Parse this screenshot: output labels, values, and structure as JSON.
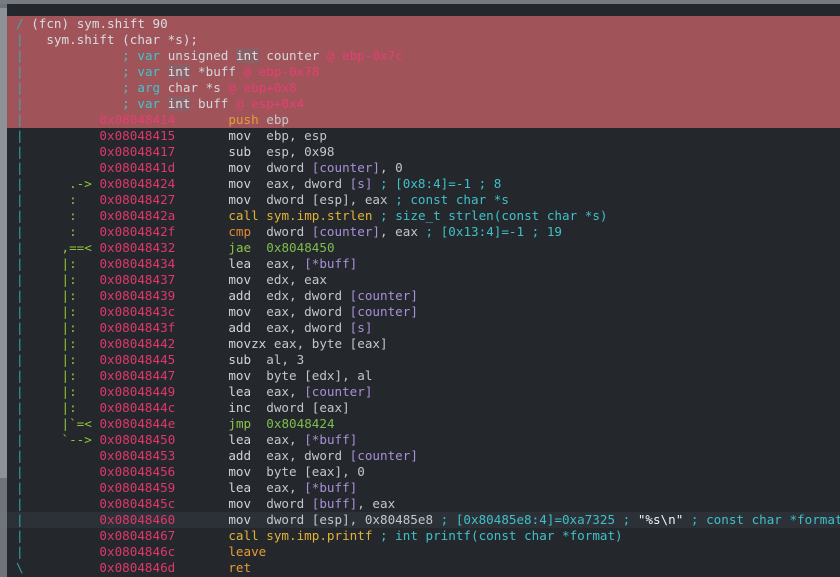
{
  "app": {
    "name": "radare2-disassembly-view",
    "theme": "dark"
  },
  "colors": {
    "background": "#24282d",
    "header_highlight": "#a0545a",
    "cursor_row": "#2c3138",
    "address": "#e0376b",
    "comment": "#3fc0c9",
    "jump": "#8bc34a",
    "call": "#e2b23a",
    "stack_op": "#e79c34",
    "variable": "#a98fd8",
    "flow_bar": "#2fa3a8",
    "arrow": "#8fc63d",
    "scrollbar": "#8d9299"
  },
  "function": {
    "marker": "/",
    "label": "(fcn)",
    "name": "sym.shift",
    "size": "90",
    "signature": "sym.shift (char *s);"
  },
  "variables": [
    {
      "gutter": "|",
      "semi": ";",
      "kind": "var",
      "qualifier": "unsigned ",
      "type": "int",
      "name": " counter ",
      "at": "@ ebp-0x7c"
    },
    {
      "gutter": "|",
      "semi": ";",
      "kind": "var",
      "qualifier": "",
      "type": "int",
      "name": " *buff ",
      "at": "@ ebp-0x78"
    },
    {
      "gutter": "|",
      "semi": ";",
      "kind": "arg",
      "qualifier": "",
      "type": "char",
      "name": " *s ",
      "at": "@ ebp+0x8"
    },
    {
      "gutter": "|",
      "semi": ";",
      "kind": "var",
      "qualifier": "",
      "type": "int",
      "name": " buff ",
      "at": "@ esp+0x4"
    }
  ],
  "instructions": [
    {
      "gutter": "|",
      "arrow": "",
      "addr": "0x08048414",
      "mn": "push",
      "mnclass": "c-push",
      "highlight": true,
      "cursor": false
    },
    {
      "gutter": "|",
      "arrow": "",
      "addr": "0x08048415",
      "mn": "mov",
      "mnclass": "c-op",
      "highlight": false,
      "cursor": false
    },
    {
      "gutter": "|",
      "arrow": "",
      "addr": "0x08048417",
      "mn": "sub",
      "mnclass": "c-op",
      "highlight": false,
      "cursor": false
    },
    {
      "gutter": "|",
      "arrow": "",
      "addr": "0x0804841d",
      "mn": "mov",
      "mnclass": "c-op",
      "highlight": false,
      "cursor": false
    },
    {
      "gutter": "|",
      "arrow": ".->",
      "addr": "0x08048424",
      "mn": "mov",
      "mnclass": "c-op",
      "highlight": false,
      "cursor": false
    },
    {
      "gutter": "|",
      "arrow": ":",
      "addr": "0x08048427",
      "mn": "mov",
      "mnclass": "c-op",
      "highlight": false,
      "cursor": false
    },
    {
      "gutter": "|",
      "arrow": ":",
      "addr": "0x0804842a",
      "mn": "call",
      "mnclass": "c-call",
      "highlight": false,
      "cursor": false
    },
    {
      "gutter": "|",
      "arrow": ":",
      "addr": "0x0804842f",
      "mn": "cmp",
      "mnclass": "c-cmp",
      "highlight": false,
      "cursor": false
    },
    {
      "gutter": "|",
      "arrow": ",==<",
      "addr": "0x08048432",
      "mn": "jae",
      "mnclass": "c-jmp",
      "highlight": false,
      "cursor": false
    },
    {
      "gutter": "|",
      "arrow": "|:",
      "addr": "0x08048434",
      "mn": "lea",
      "mnclass": "c-op",
      "highlight": false,
      "cursor": false
    },
    {
      "gutter": "|",
      "arrow": "|:",
      "addr": "0x08048437",
      "mn": "mov",
      "mnclass": "c-op",
      "highlight": false,
      "cursor": false
    },
    {
      "gutter": "|",
      "arrow": "|:",
      "addr": "0x08048439",
      "mn": "add",
      "mnclass": "c-op",
      "highlight": false,
      "cursor": false
    },
    {
      "gutter": "|",
      "arrow": "|:",
      "addr": "0x0804843c",
      "mn": "mov",
      "mnclass": "c-op",
      "highlight": false,
      "cursor": false
    },
    {
      "gutter": "|",
      "arrow": "|:",
      "addr": "0x0804843f",
      "mn": "add",
      "mnclass": "c-op",
      "highlight": false,
      "cursor": false
    },
    {
      "gutter": "|",
      "arrow": "|:",
      "addr": "0x08048442",
      "mn": "movzx",
      "mnclass": "c-op",
      "highlight": false,
      "cursor": false
    },
    {
      "gutter": "|",
      "arrow": "|:",
      "addr": "0x08048445",
      "mn": "sub",
      "mnclass": "c-op",
      "highlight": false,
      "cursor": false
    },
    {
      "gutter": "|",
      "arrow": "|:",
      "addr": "0x08048447",
      "mn": "mov",
      "mnclass": "c-op",
      "highlight": false,
      "cursor": false
    },
    {
      "gutter": "|",
      "arrow": "|:",
      "addr": "0x08048449",
      "mn": "lea",
      "mnclass": "c-op",
      "highlight": false,
      "cursor": false
    },
    {
      "gutter": "|",
      "arrow": "|:",
      "addr": "0x0804844c",
      "mn": "inc",
      "mnclass": "c-op",
      "highlight": false,
      "cursor": false
    },
    {
      "gutter": "|",
      "arrow": "|`=<",
      "addr": "0x0804844e",
      "mn": "jmp",
      "mnclass": "c-jmp",
      "highlight": false,
      "cursor": false
    },
    {
      "gutter": "|",
      "arrow": "`-->",
      "addr": "0x08048450",
      "mn": "lea",
      "mnclass": "c-op",
      "highlight": false,
      "cursor": false
    },
    {
      "gutter": "|",
      "arrow": "",
      "addr": "0x08048453",
      "mn": "add",
      "mnclass": "c-op",
      "highlight": false,
      "cursor": false
    },
    {
      "gutter": "|",
      "arrow": "",
      "addr": "0x08048456",
      "mn": "mov",
      "mnclass": "c-op",
      "highlight": false,
      "cursor": false
    },
    {
      "gutter": "|",
      "arrow": "",
      "addr": "0x08048459",
      "mn": "lea",
      "mnclass": "c-op",
      "highlight": false,
      "cursor": false
    },
    {
      "gutter": "|",
      "arrow": "",
      "addr": "0x0804845c",
      "mn": "mov",
      "mnclass": "c-op",
      "highlight": false,
      "cursor": false
    },
    {
      "gutter": "|",
      "arrow": "",
      "addr": "0x08048460",
      "mn": "mov",
      "mnclass": "c-op",
      "highlight": false,
      "cursor": true
    },
    {
      "gutter": "|",
      "arrow": "",
      "addr": "0x08048467",
      "mn": "call",
      "mnclass": "c-call",
      "highlight": false,
      "cursor": false
    },
    {
      "gutter": "|",
      "arrow": "",
      "addr": "0x0804846c",
      "mn": "leave",
      "mnclass": "c-push",
      "highlight": false,
      "cursor": false
    },
    {
      "gutter": "\\",
      "arrow": "",
      "addr": "0x0804846d",
      "mn": "ret",
      "mnclass": "c-push",
      "highlight": false,
      "cursor": false
    }
  ],
  "operands": {
    "push_ebp": "ebp",
    "mov_ebp_esp": "ebp, esp",
    "sub_esp": "esp, 0x98",
    "mov_counter_0_pre": "dword ",
    "mov_counter_0_var": "[counter]",
    "mov_counter_0_post": ", 0",
    "mov_eax_s_pre": "eax, dword ",
    "mov_eax_s_var": "[s]",
    "mov_esp_eax": "dword [esp], eax",
    "call_strlen": "sym.imp.strlen",
    "cmp_counter_pre": "dword ",
    "cmp_counter_var": "[counter]",
    "cmp_counter_post": ", eax",
    "jae_target": "0x8048450",
    "lea_buff_pre": "eax, ",
    "lea_buff_var": "[*buff]",
    "mov_edx_eax": "edx, eax",
    "add_edx_counter_pre": "edx, dword ",
    "add_edx_counter_var": "[counter]",
    "mov_eax_counter_pre": "eax, dword ",
    "mov_eax_counter_var": "[counter]",
    "add_eax_s_pre": "eax, dword ",
    "add_eax_s_var": "[s]",
    "movzx_eax_byte": "eax, byte [eax]",
    "sub_al_3": "al, 3",
    "mov_byte_edx_al": "byte [edx], al",
    "lea_eax_counter_pre": "eax, ",
    "lea_eax_counter_var": "[counter]",
    "inc_dword_eax": "dword [eax]",
    "jmp_target": "0x8048424",
    "add_eax_counter2_pre": "eax, dword ",
    "add_eax_counter2_var": "[counter]",
    "mov_byte_eax_0": "byte [eax], 0",
    "mov_buff_eax_pre": "dword ",
    "mov_buff_eax_var": "[buff]",
    "mov_buff_eax_post": ", eax",
    "mov_esp_fmt": "dword [esp], 0x80485e8",
    "call_printf": "sym.imp.printf"
  },
  "comments": {
    "mov_eax_s": "; [0x8:4]=-1 ; 8",
    "mov_esp_eax": "; const char *s",
    "call_strlen": "; size_t strlen(const char *s)",
    "cmp_counter": "; [0x13:4]=-1 ; 19",
    "fmt_ref": "; [0x80485e8:4]=0xa7325 ;",
    "fmt_str": "\"%s\\n\"",
    "fmt_type": "; const char *format",
    "call_printf": "; int printf(const char *format)"
  }
}
